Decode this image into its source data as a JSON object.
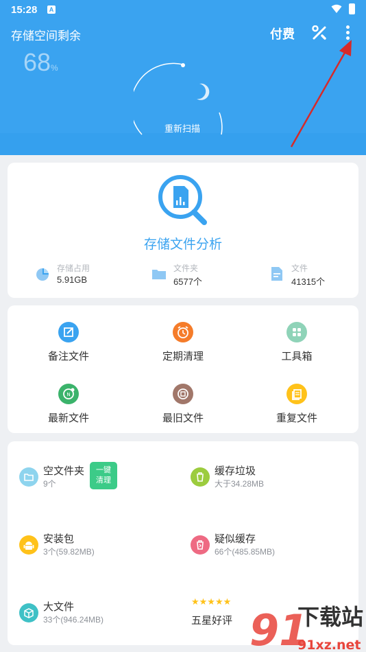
{
  "status_bar": {
    "time": "15:28",
    "notif_letter": "A"
  },
  "header": {
    "title": "存储空间剩余",
    "percent": "68",
    "percent_unit": "%",
    "pay_label": "付费",
    "rescan_label": "重新扫描",
    "accent_color": "#3aa3f0"
  },
  "analysis": {
    "title": "存储文件分析",
    "stats": [
      {
        "label": "存储占用",
        "value": "5.91GB",
        "icon": "pie-chart-icon"
      },
      {
        "label": "文件夹",
        "value": "6577个",
        "icon": "folder-icon"
      },
      {
        "label": "文件",
        "value": "41315个",
        "icon": "document-icon"
      }
    ]
  },
  "tools": [
    {
      "label": "备注文件",
      "icon": "note-edit-icon",
      "color": "#3aa3f0"
    },
    {
      "label": "定期清理",
      "icon": "alarm-clock-icon",
      "color": "#f57c2a"
    },
    {
      "label": "工具箱",
      "icon": "toolbox-icon",
      "color": "#8fd3b8"
    },
    {
      "label": "最新文件",
      "icon": "newest-file-icon",
      "color": "#3bb36b"
    },
    {
      "label": "最旧文件",
      "icon": "oldest-file-icon",
      "color": "#a1776a"
    },
    {
      "label": "重复文件",
      "icon": "duplicate-file-icon",
      "color": "#ffc21a"
    }
  ],
  "cleanup": {
    "empty_folder": {
      "name": "空文件夹",
      "sub": "9个",
      "icon": "empty-folder-icon",
      "color": "#8ed4ee"
    },
    "oneclick_line1": "一键",
    "oneclick_line2": "清理",
    "cache": {
      "name": "缓存垃圾",
      "sub": "大于34.28MB",
      "icon": "trash-icon",
      "color": "#9ccc3e"
    },
    "apk": {
      "name": "安装包",
      "sub": "3个(59.82MB)",
      "icon": "android-icon",
      "color": "#ffc21a"
    },
    "suspect_cache": {
      "name": "疑似缓存",
      "sub": "66个(485.85MB)",
      "icon": "suspect-trash-icon",
      "color": "#ee6a83"
    },
    "big_file": {
      "name": "大文件",
      "sub": "33个(946.24MB)",
      "icon": "box-icon",
      "color": "#3fc1c6"
    },
    "stars": "★★★★★",
    "rate_label": "五星好评"
  },
  "watermark": {
    "main": "下载站",
    "site": "91xz.net",
    "logo": "91"
  }
}
